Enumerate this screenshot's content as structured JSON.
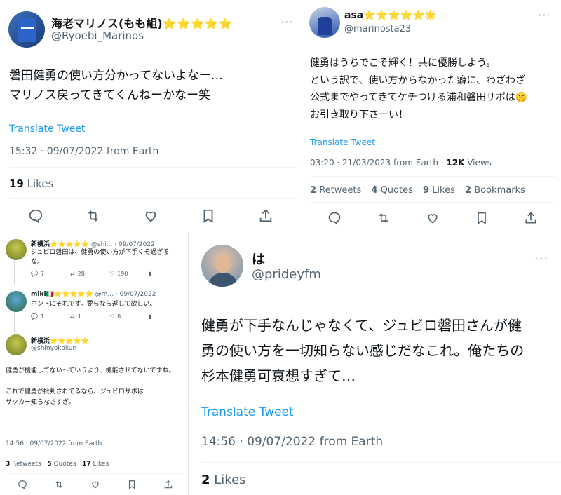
{
  "tweet_top_left": {
    "display_name": "海老マリノス(もも組)⭐⭐⭐⭐⭐",
    "handle": "@Ryoebi_Marinos",
    "text": "磐田健勇の使い方分かってないよなー…\nマリノス戻ってきてくんねーかなー笑",
    "translate": "Translate Tweet",
    "timestamp": "15:32 · 09/07/2022 from Earth",
    "likes_count": "19",
    "likes_label": "Likes",
    "more": "···",
    "actions": [
      "reply-icon",
      "retweet-icon",
      "like-icon",
      "bookmark-icon",
      "share-icon"
    ]
  },
  "tweet_top_right": {
    "display_name": "asa⭐⭐⭐⭐⭐🌟",
    "handle": "@marinosta23",
    "text": "健勇はうちでこそ輝く！共に優勝しよう。\nという訳で、使い方からなかった癖に、わざわざ\n公式までやってきてケチつける浦和磐田サポは🤫\nお引き取り下さーい！",
    "translate": "Translate Tweet",
    "timestamp": "03:20 · 21/03/2023 from Earth · ",
    "views_count": "12K",
    "views_label": "Views",
    "stats": [
      {
        "count": "2",
        "label": "Retweets"
      },
      {
        "count": "4",
        "label": "Quotes"
      },
      {
        "count": "9",
        "label": "Likes"
      },
      {
        "count": "2",
        "label": "Bookmarks"
      }
    ],
    "more": "···"
  },
  "thread_bottom_left": {
    "replies": [
      {
        "name": "新横浜⭐⭐⭐⭐⭐",
        "meta": "@shi... · 09/07/2022",
        "text": "ジュビロ磐田は、健勇の使い方が下手くそ過ぎるな。",
        "reply": "7",
        "retweet": "28",
        "like": "190"
      },
      {
        "name": "miki🇮🇹⭐⭐⭐⭐⭐",
        "meta": "@m... · 09/07/2022",
        "text": "ホントにそれです。要らなら返して欲しい。",
        "reply": "1",
        "retweet": "1",
        "like": "8"
      }
    ],
    "main": {
      "name": "新横浜⭐⭐⭐⭐⭐",
      "handle": "@shinyokokun",
      "text": "健勇が機能してないっていうより、機能させてないですね。\n\nこれで健勇が批判されてるなら、ジュビロサポは\nサッカー知らなさすぎ。",
      "timestamp": "14:56 · 09/07/2022 from Earth",
      "stats": [
        {
          "count": "3",
          "label": "Retweets"
        },
        {
          "count": "5",
          "label": "Quotes"
        },
        {
          "count": "17",
          "label": "Likes"
        }
      ]
    },
    "more": "···"
  },
  "tweet_bottom_right": {
    "display_name": "は",
    "handle": "@prideyfm",
    "text": "健勇が下手なんじゃなくて、ジュビロ磐田さんが健\n勇の使い方を一切知らない感じだなこれ。俺たちの\n杉本健勇可哀想すぎて…",
    "translate": "Translate Tweet",
    "timestamp": "14:56 · 09/07/2022 from Earth",
    "likes_count": "2",
    "likes_label": "Likes",
    "more": "···"
  }
}
